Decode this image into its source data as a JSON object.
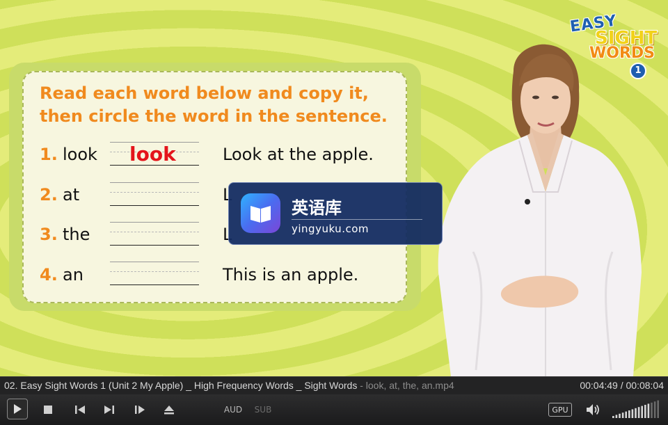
{
  "worksheet": {
    "instruction_line1": "Read each word below and copy it,",
    "instruction_line2": "then circle the word in the sentence.",
    "rows": [
      {
        "num": "1.",
        "word": "look",
        "sentence": "Look at the apple."
      },
      {
        "num": "2.",
        "word": "at",
        "sentence": "L"
      },
      {
        "num": "3.",
        "word": "the",
        "sentence": "L"
      },
      {
        "num": "4.",
        "word": "an",
        "sentence": "This is an apple."
      }
    ],
    "written_answer": "look"
  },
  "logo": {
    "line1": "EASY",
    "line2": "SIGHT",
    "line3": "WORDS",
    "number": "1"
  },
  "watermark": {
    "title": "英语库",
    "subtitle": "yingyuku.com"
  },
  "player": {
    "filename": "02. Easy Sight Words 1 (Unit 2 My Apple)  _ High Frequency Words _ Sight Words",
    "filename_rest": "  - look, at, the, an.mp4",
    "time": "00:04:49 / 00:08:04",
    "aud_label": "AUD",
    "sub_label": "SUB",
    "gpu_label": "GPU",
    "volume_level": 0.75
  },
  "colors": {
    "accent_orange": "#f08a1e",
    "answer_red": "#e4141b",
    "player_bg": "#232324"
  }
}
